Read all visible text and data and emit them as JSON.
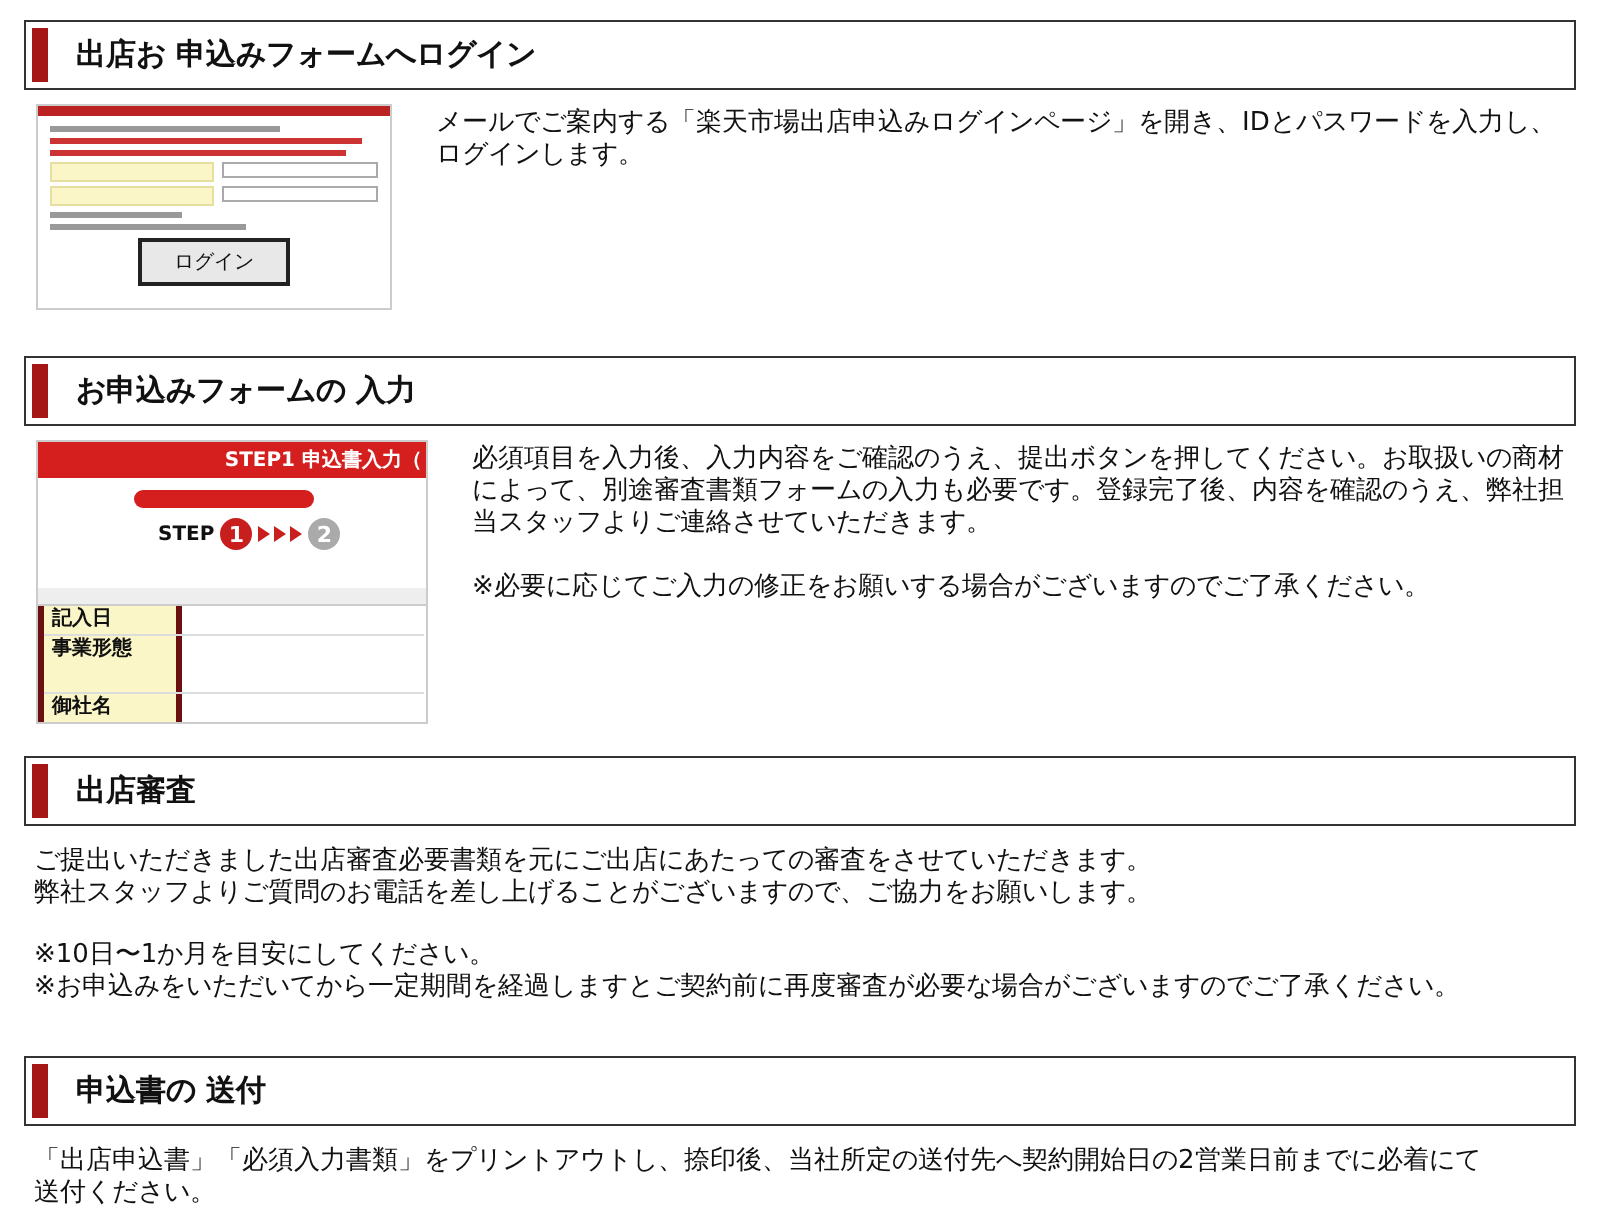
{
  "sections": [
    {
      "heading": "出店お 申込みフォームへログイン",
      "kind": "login",
      "thumbnail": {
        "button": "ログイン"
      },
      "paragraphs": [
        [
          "メールでご案内する「楽天市場出店申込みログインページ」を開き、IDとパスワードを入力し、ログインします。"
        ]
      ]
    },
    {
      "heading": "お申込みフォームの 入力",
      "kind": "form",
      "thumbnail": {
        "banner": "STEP1 申込書入力（",
        "step_label": "STEP",
        "steps": [
          "1",
          "2"
        ],
        "fields": [
          "記入日",
          "事業形態",
          "御社名"
        ]
      },
      "paragraphs": [
        [
          "必須項目を入力後、入力内容をご確認のうえ、提出ボタンを押してください。お取扱いの商材によって、別途審査書類フォームの入力も必要です。登録完了後、内容を確認のうえ、弊社担当スタッフよりご連絡させていただきます。"
        ],
        [
          "※必要に応じてご入力の修正をお願いする場合がございますのでご了承ください。"
        ]
      ]
    },
    {
      "heading": "出店審査",
      "kind": "plain",
      "paragraphs": [
        [
          "ご提出いただきました出店審査必要書類を元にご出店にあたっての審査をさせていただきます。",
          "弊社スタッフよりご質問のお電話を差し上げることがございますので、ご協力をお願いします。"
        ],
        [
          "※10日〜1か月を目安にしてください。",
          "※お申込みをいただいてから一定期間を経過しますとご契約前に再度審査が必要な場合がございますのでご了承ください。"
        ]
      ]
    },
    {
      "heading": "申込書の 送付",
      "kind": "plain",
      "paragraphs": [
        [
          "「出店申込書」「必須入力書類」をプリントアウトし、捺印後、当社所定の送付先へ契約開始日の2営業日前までに必着にて",
          "送付ください。"
        ]
      ]
    }
  ]
}
